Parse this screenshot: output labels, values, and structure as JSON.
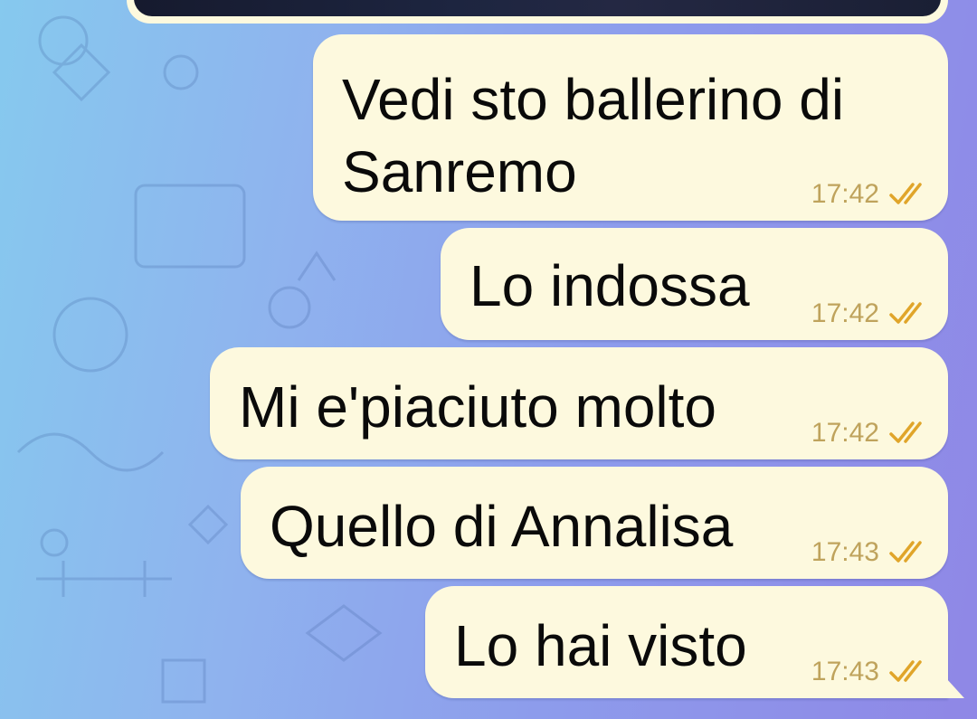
{
  "chat": {
    "messages": [
      {
        "text": "Vedi sto ballerino di Sanremo",
        "time": "17:42",
        "status_icon": "double-check-icon"
      },
      {
        "text": "Lo indossa",
        "time": "17:42",
        "status_icon": "double-check-icon"
      },
      {
        "text": "Mi e'piaciuto molto",
        "time": "17:42",
        "status_icon": "double-check-icon"
      },
      {
        "text": "Quello di Annalisa",
        "time": "17:43",
        "status_icon": "double-check-icon"
      },
      {
        "text": "Lo hai visto",
        "time": "17:43",
        "status_icon": "double-check-icon"
      }
    ]
  },
  "colors": {
    "bubble": "#fdf9de",
    "time": "#bfa35c",
    "tick": "#e0a52a"
  }
}
